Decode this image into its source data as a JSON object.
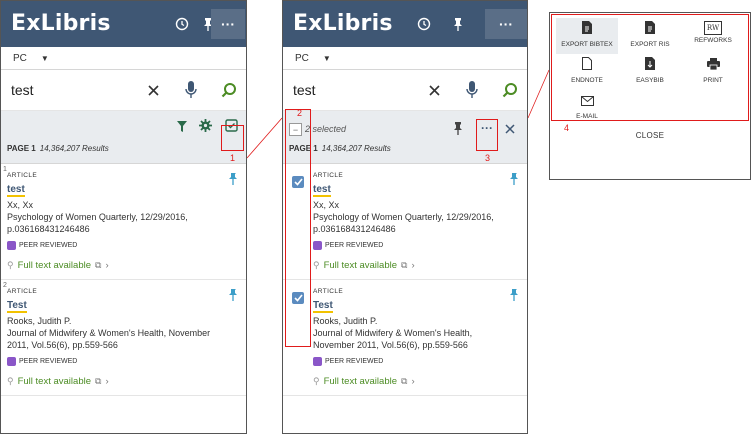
{
  "app": {
    "logo": "ExLibris"
  },
  "scope": {
    "value": "PC"
  },
  "search": {
    "query": "test"
  },
  "results": {
    "page": "PAGE 1",
    "count": "14,364,207 Results"
  },
  "selection": {
    "label": "2 selected"
  },
  "items": [
    {
      "num": "1",
      "type": "ARTICLE",
      "title": "test",
      "authors": "Xx, Xx",
      "source1": "Psychology of Women Quarterly, 12/29/2016,",
      "source2": "p.036168431246486",
      "peer": "PEER REVIEWED",
      "fulltext": "Full text available"
    },
    {
      "num": "2",
      "type": "ARTICLE",
      "title": "Test",
      "authors": "Rooks, Judith P.",
      "source1": "Journal of Midwifery & Women's Health, November",
      "source2": "2011, Vol.56(6), pp.559-566",
      "source1b": "Journal of Midwifery & Women's Health,",
      "source2b": "November 2011, Vol.56(6), pp.559-566",
      "peer": "PEER REVIEWED",
      "fulltext": "Full text available"
    }
  ],
  "export_menu": {
    "options": [
      "EXPORT BIBTEX",
      "EXPORT RIS",
      "REFWORKS",
      "ENDNOTE",
      "EASYBIB",
      "PRINT",
      "E-MAIL"
    ],
    "refworks_badge": "RW",
    "close": "CLOSE"
  },
  "callouts": [
    "1",
    "2",
    "3",
    "4"
  ],
  "colors": {
    "header": "#3f5774",
    "accent_green": "#4c8c24",
    "callout_red": "#e01b1b",
    "checkbox_blue": "#5b8bbf",
    "peer_purple": "#8a56c8"
  },
  "icons": [
    "history-icon",
    "pin-icon",
    "more-icon",
    "close-icon",
    "microphone-icon",
    "search-icon",
    "filter-icon",
    "gear-icon",
    "select-mode-icon",
    "link-icon",
    "external-link-icon",
    "chevron-right-icon",
    "collapse-checkbox-icon",
    "checkbox-icon",
    "bibtex-icon",
    "ris-icon",
    "endnote-icon",
    "easybib-icon",
    "print-icon",
    "email-icon"
  ]
}
